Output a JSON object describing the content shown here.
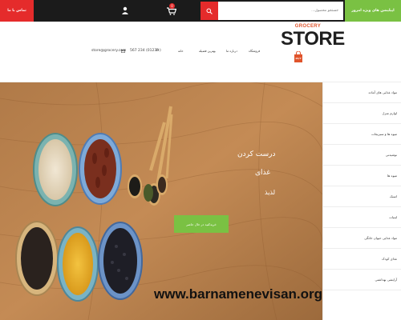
{
  "topbar": {
    "offers_label": "اپیلیشن های ویژه امروز",
    "search_placeholder": "جستجو محصول...",
    "cart_count": "0",
    "contact_label": "تماس با ما"
  },
  "header": {
    "email": "store@grocery.com",
    "phone": "567 234 (0123+)",
    "nav": [
      "خانه",
      "بهترین فضیله",
      "درباره ما",
      "فروشگاه"
    ],
    "logo": {
      "top": "GROCERY",
      "main": "STORE",
      "bag": "24/7"
    }
  },
  "hero": {
    "title": "درست کردن",
    "line2": "غذای",
    "line3": "لذیذ",
    "shop_button": "خریدکنید در حال حاضر",
    "watermark": "www.barnamenevisan.org"
  },
  "sidebar": {
    "categories": [
      "مواد غذایی های آماده",
      "لوازم منزل",
      "میوه ها و سبزیجات",
      "نوشیدنی",
      "میوه ها",
      "اسنک",
      "لبنیات",
      "مواد غذایی حیوان خانگی",
      "غذای کودک",
      "آرایشی بهداشتی"
    ]
  },
  "colors": {
    "accent_red": "#e52b2b",
    "accent_green": "#7ac143",
    "dark_bar": "#1b1b1b"
  }
}
